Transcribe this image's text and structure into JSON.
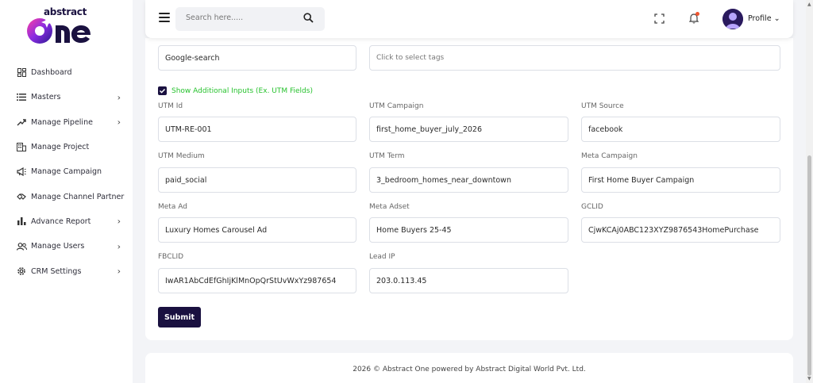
{
  "brand": {
    "top": "abstract",
    "main": "One",
    "accent": "#7b2ff7"
  },
  "sidebar": {
    "items": [
      {
        "label": "Dashboard",
        "icon": "dashboard-icon",
        "has_children": false
      },
      {
        "label": "Masters",
        "icon": "list-icon",
        "has_children": true
      },
      {
        "label": "Manage Pipeline",
        "icon": "pipeline-icon",
        "has_children": true
      },
      {
        "label": "Manage Project",
        "icon": "building-icon",
        "has_children": false
      },
      {
        "label": "Manage Campaign",
        "icon": "megaphone-icon",
        "has_children": false
      },
      {
        "label": "Manage Channel Partner",
        "icon": "handshake-icon",
        "has_children": false
      },
      {
        "label": "Advance Report",
        "icon": "bar-chart-icon",
        "has_children": true
      },
      {
        "label": "Manage Users",
        "icon": "users-icon",
        "has_children": true
      },
      {
        "label": "CRM Settings",
        "icon": "gear-icon",
        "has_children": true
      }
    ]
  },
  "topbar": {
    "search_placeholder": "Search here.....",
    "profile_label": "Profile"
  },
  "form": {
    "source_value": "Google-search",
    "tags_placeholder": "Click to select tags",
    "show_additional_label": "Show Additional Inputs (Ex. UTM Fields)",
    "show_additional_checked": true,
    "fields": {
      "utm_id": {
        "label": "UTM Id",
        "value": "UTM-RE-001"
      },
      "utm_campaign": {
        "label": "UTM Campaign",
        "value": "first_home_buyer_july_2026"
      },
      "utm_source": {
        "label": "UTM Source",
        "value": "facebook"
      },
      "utm_medium": {
        "label": "UTM Medium",
        "value": "paid_social"
      },
      "utm_term": {
        "label": "UTM Term",
        "value": "3_bedroom_homes_near_downtown"
      },
      "meta_campaign": {
        "label": "Meta Campaign",
        "value": "First Home Buyer Campaign"
      },
      "meta_ad": {
        "label": "Meta Ad",
        "value": "Luxury Homes Carousel Ad"
      },
      "meta_adset": {
        "label": "Meta Adset",
        "value": "Home Buyers 25-45"
      },
      "gclid": {
        "label": "GCLID",
        "value": "CjwKCAj0ABC123XYZ9876543HomePurchase"
      },
      "fbclid": {
        "label": "FBCLID",
        "value": "IwAR1AbCdEfGhIjKlMnOpQrStUvWxYz987654"
      },
      "lead_ip": {
        "label": "Lead IP",
        "value": "203.0.113.45"
      }
    },
    "submit_label": "Submit"
  },
  "footer": {
    "text": "2026 © Abstract One powered by Abstract Digital World Pvt. Ltd."
  },
  "colors": {
    "primary": "#1a1140",
    "success": "#27c22e",
    "notification": "#f0552f"
  }
}
